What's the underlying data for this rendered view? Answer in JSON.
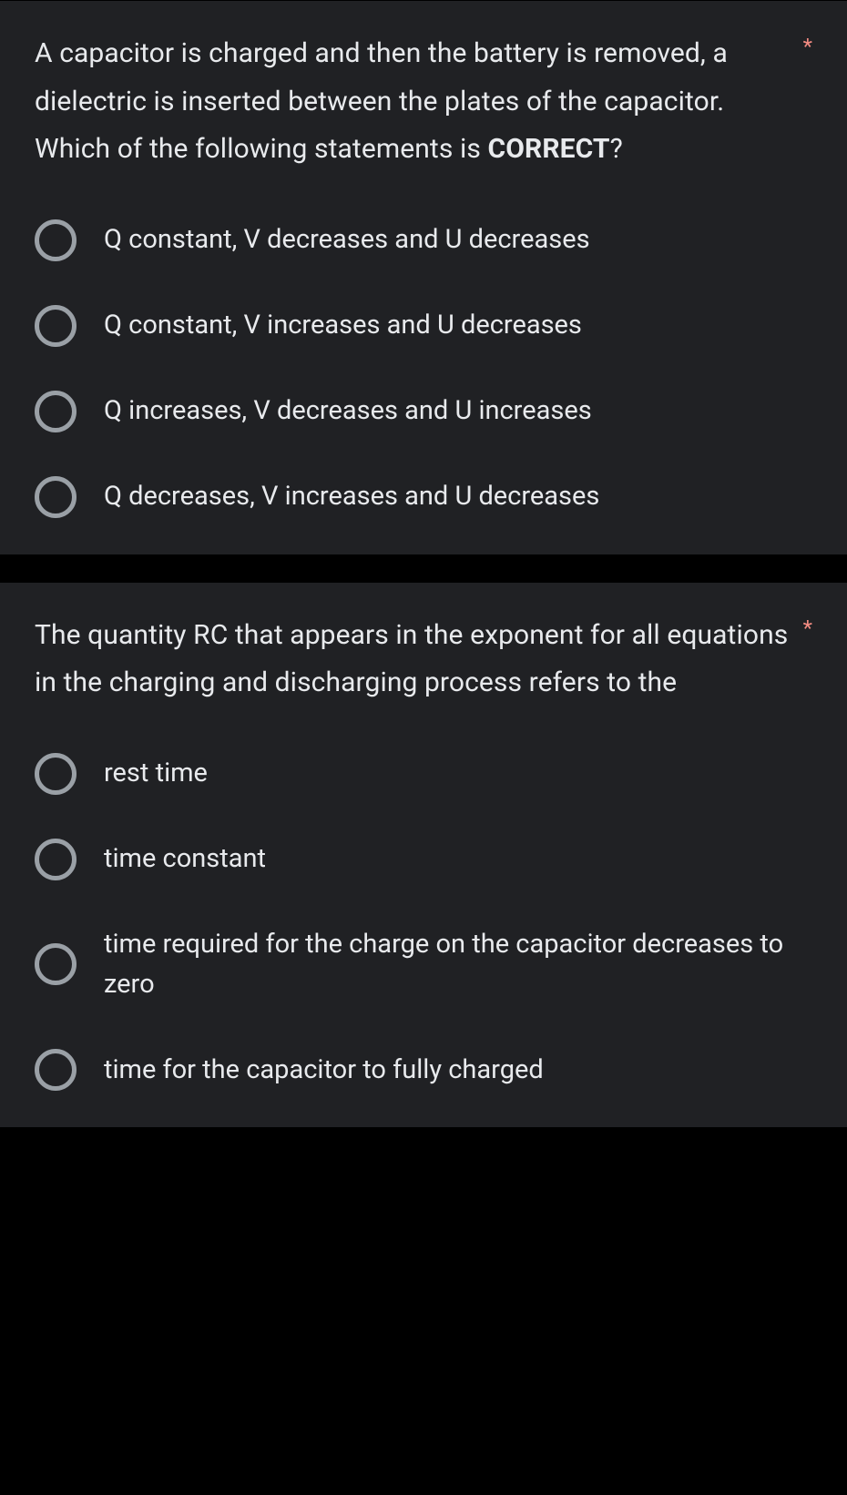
{
  "questions": [
    {
      "text_prefix": "A capacitor is charged and then the battery is removed, a dielectric is inserted between the plates of the capacitor. Which of the following statements is ",
      "text_bold": "CORRECT",
      "text_suffix": "?",
      "required_mark": "*",
      "options": [
        "Q constant, V decreases and U decreases",
        "Q constant, V increases and U decreases",
        "Q increases, V decreases and U increases",
        "Q decreases, V increases and U decreases"
      ]
    },
    {
      "text_prefix": "The quantity RC that appears in the exponent for all equations in the charging and discharging process refers to the",
      "text_bold": "",
      "text_suffix": "",
      "required_mark": "*",
      "options": [
        "rest time",
        "time constant",
        "time required for the charge on the capacitor decreases to zero",
        "time for the capacitor to fully charged"
      ]
    }
  ]
}
